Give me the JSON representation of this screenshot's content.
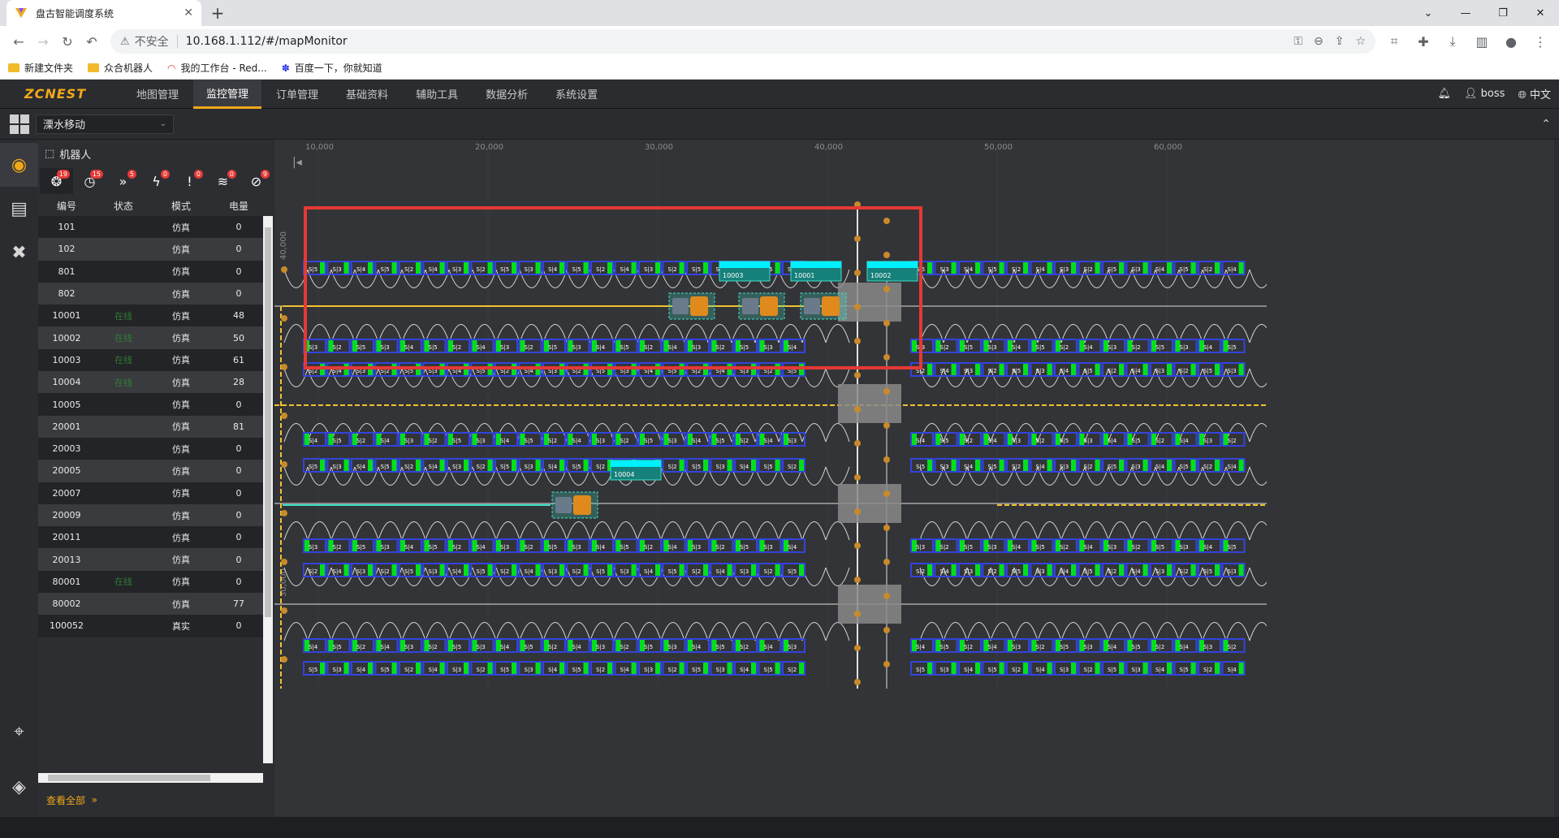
{
  "browser": {
    "tab_title": "盘古智能调度系统",
    "url": "10.168.1.112/#/mapMonitor",
    "insecure_label": "不安全",
    "bookmarks": [
      "新建文件夹",
      "众合机器人",
      "我的工作台 - Red...",
      "百度一下，你就知道"
    ]
  },
  "app": {
    "logo": "ZCNEST",
    "nav": [
      "地图管理",
      "监控管理",
      "订单管理",
      "基础资料",
      "辅助工具",
      "数据分析",
      "系统设置"
    ],
    "user": "boss",
    "lang": "中文",
    "map_select": "溧水移动"
  },
  "panel": {
    "title": "机器人",
    "filter_badges": [
      "19",
      "15",
      "5",
      "0",
      "0",
      "0",
      "9"
    ],
    "headers": [
      "编号",
      "状态",
      "模式",
      "电量"
    ],
    "view_all": "查看全部",
    "rows": [
      {
        "id": "101",
        "status": "",
        "mode": "仿真",
        "battery": "0"
      },
      {
        "id": "102",
        "status": "",
        "mode": "仿真",
        "battery": "0"
      },
      {
        "id": "801",
        "status": "",
        "mode": "仿真",
        "battery": "0"
      },
      {
        "id": "802",
        "status": "",
        "mode": "仿真",
        "battery": "0"
      },
      {
        "id": "10001",
        "status": "在线",
        "mode": "仿真",
        "battery": "48"
      },
      {
        "id": "10002",
        "status": "在线",
        "mode": "仿真",
        "battery": "50"
      },
      {
        "id": "10003",
        "status": "在线",
        "mode": "仿真",
        "battery": "61"
      },
      {
        "id": "10004",
        "status": "在线",
        "mode": "仿真",
        "battery": "28"
      },
      {
        "id": "10005",
        "status": "",
        "mode": "仿真",
        "battery": "0"
      },
      {
        "id": "20001",
        "status": "",
        "mode": "仿真",
        "battery": "81"
      },
      {
        "id": "20003",
        "status": "",
        "mode": "仿真",
        "battery": "0"
      },
      {
        "id": "20005",
        "status": "",
        "mode": "仿真",
        "battery": "0"
      },
      {
        "id": "20007",
        "status": "",
        "mode": "仿真",
        "battery": "0"
      },
      {
        "id": "20009",
        "status": "",
        "mode": "仿真",
        "battery": "0"
      },
      {
        "id": "20011",
        "status": "",
        "mode": "仿真",
        "battery": "0"
      },
      {
        "id": "20013",
        "status": "",
        "mode": "仿真",
        "battery": "0"
      },
      {
        "id": "80001",
        "status": "在线",
        "mode": "仿真",
        "battery": "0"
      },
      {
        "id": "80002",
        "status": "",
        "mode": "仿真",
        "battery": "77"
      },
      {
        "id": "100052",
        "status": "",
        "mode": "真实",
        "battery": "0"
      }
    ]
  },
  "map": {
    "x_ticks": [
      "10,000",
      "20,000",
      "30,000",
      "40,000",
      "50,000",
      "60,000"
    ],
    "y_ticks": [
      "40,000",
      "30,000"
    ],
    "robot_tags": [
      "10003",
      "10001",
      "10002",
      "10004"
    ],
    "slot_labels": [
      "S|5",
      "S|3",
      "S|2",
      "S|4"
    ],
    "colors": {
      "accent": "#f0a81a",
      "slot_border": "#3344dd",
      "slot_fill": "#00e01a",
      "highlight": "#e53935",
      "path": "#ffffff",
      "route_yellow": "#f2c12e",
      "route_cyan": "#3fe0c8"
    }
  }
}
